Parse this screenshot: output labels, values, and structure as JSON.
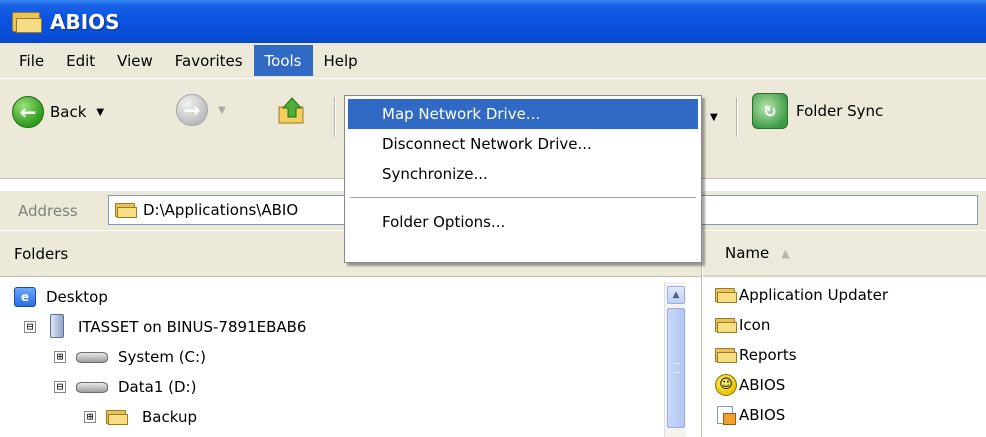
{
  "window": {
    "title": "ABIOS"
  },
  "menubar": {
    "items": [
      {
        "label": "File"
      },
      {
        "label": "Edit"
      },
      {
        "label": "View"
      },
      {
        "label": "Favorites"
      },
      {
        "label": "Tools"
      },
      {
        "label": "Help"
      }
    ],
    "active": "Tools"
  },
  "tools_menu": {
    "items": [
      {
        "label": "Map Network Drive..."
      },
      {
        "label": "Disconnect Network Drive..."
      },
      {
        "label": "Synchronize..."
      },
      {
        "label": "Folder Options..."
      }
    ],
    "highlighted": "Map Network Drive..."
  },
  "toolbar": {
    "back_label": "Back",
    "sync_label": "Folder Sync"
  },
  "address": {
    "label": "Address",
    "value": "D:\\Applications\\ABIO"
  },
  "folders_pane": {
    "header": "Folders",
    "tree": [
      {
        "label": "Desktop",
        "icon": "desktop-icon"
      },
      {
        "label": "ITASSET on BINUS-7891EBAB6",
        "icon": "computer-icon",
        "expander": "⊟"
      },
      {
        "label": "System (C:)",
        "icon": "drive-icon",
        "expander": "⊞"
      },
      {
        "label": "Data1 (D:)",
        "icon": "drive-icon",
        "expander": "⊟"
      },
      {
        "label": "Backup",
        "icon": "folder-icon",
        "expander": "⊞"
      }
    ]
  },
  "files_pane": {
    "column_header": "Name",
    "sort_indicator": "▲",
    "items": [
      {
        "label": "Application Updater",
        "icon": "folder-icon"
      },
      {
        "label": "Icon",
        "icon": "folder-icon"
      },
      {
        "label": "Reports",
        "icon": "folder-icon"
      },
      {
        "label": "ABIOS",
        "icon": "smiley-icon"
      },
      {
        "label": "ABIOS",
        "icon": "application-icon"
      }
    ]
  },
  "colors": {
    "titlebar": "#0a53e0",
    "menu_highlight": "#316ac5",
    "chrome": "#ece9d8"
  }
}
